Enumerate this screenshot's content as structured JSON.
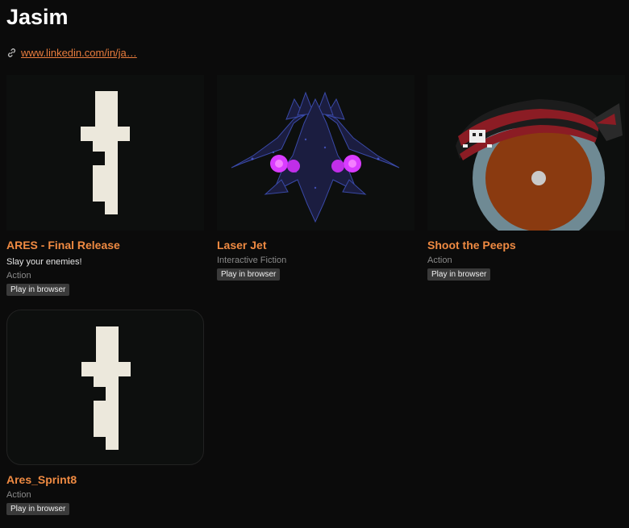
{
  "profile": {
    "name": "Jasim",
    "link_text": "www.linkedin.com/in/ja…"
  },
  "games": [
    {
      "title": "ARES - Final Release",
      "short_text": "Slay your enemies!",
      "genre": "Action",
      "badge": "Play in browser",
      "thumbnail_icon": "ares-sword-icon"
    },
    {
      "title": "Laser Jet",
      "genre": "Interactive Fiction",
      "badge": "Play in browser",
      "thumbnail_icon": "spaceship-icon"
    },
    {
      "title": "Shoot the Peeps",
      "genre": "Action",
      "badge": "Play in browser",
      "thumbnail_icon": "pirate-eye-icon"
    },
    {
      "title": "Ares_Sprint8",
      "genre": "Action",
      "badge": "Play in browser",
      "thumbnail_icon": "ares-sword-icon"
    }
  ],
  "colors": {
    "background": "#0b0b0b",
    "title_accent": "#ef8a42",
    "link": "#e97c3d",
    "badge_bg": "#3a3a3a"
  }
}
